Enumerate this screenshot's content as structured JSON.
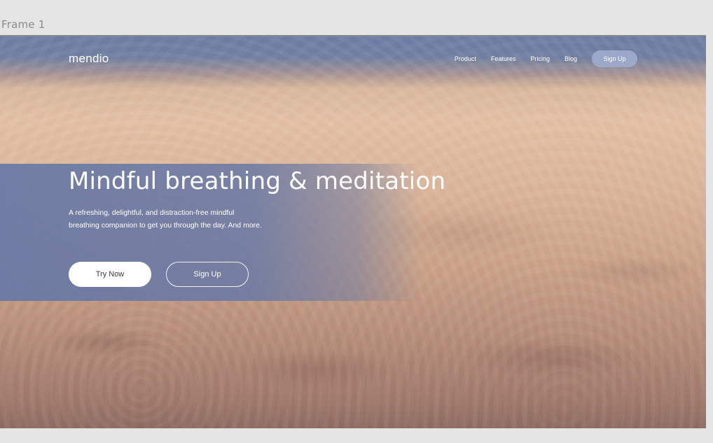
{
  "frame": {
    "label": "Frame 1"
  },
  "nav": {
    "logo": "mendio",
    "links": [
      "Product",
      "Features",
      "Pricing",
      "Blog"
    ],
    "signup": "Sign Up"
  },
  "hero": {
    "headline": "Mindful breathing & meditation",
    "subtext_line1": "A refreshing, delightful, and distraction-free mindful",
    "subtext_line2": "breathing companion to get you through the day. And more.",
    "primary_button": "Try Now",
    "secondary_button": "Sign Up"
  },
  "colors": {
    "canvas": "#e5e5e5",
    "sky_top": "#6d7fa6",
    "clouds": "#d9b59b",
    "panel": "#6878a5"
  }
}
